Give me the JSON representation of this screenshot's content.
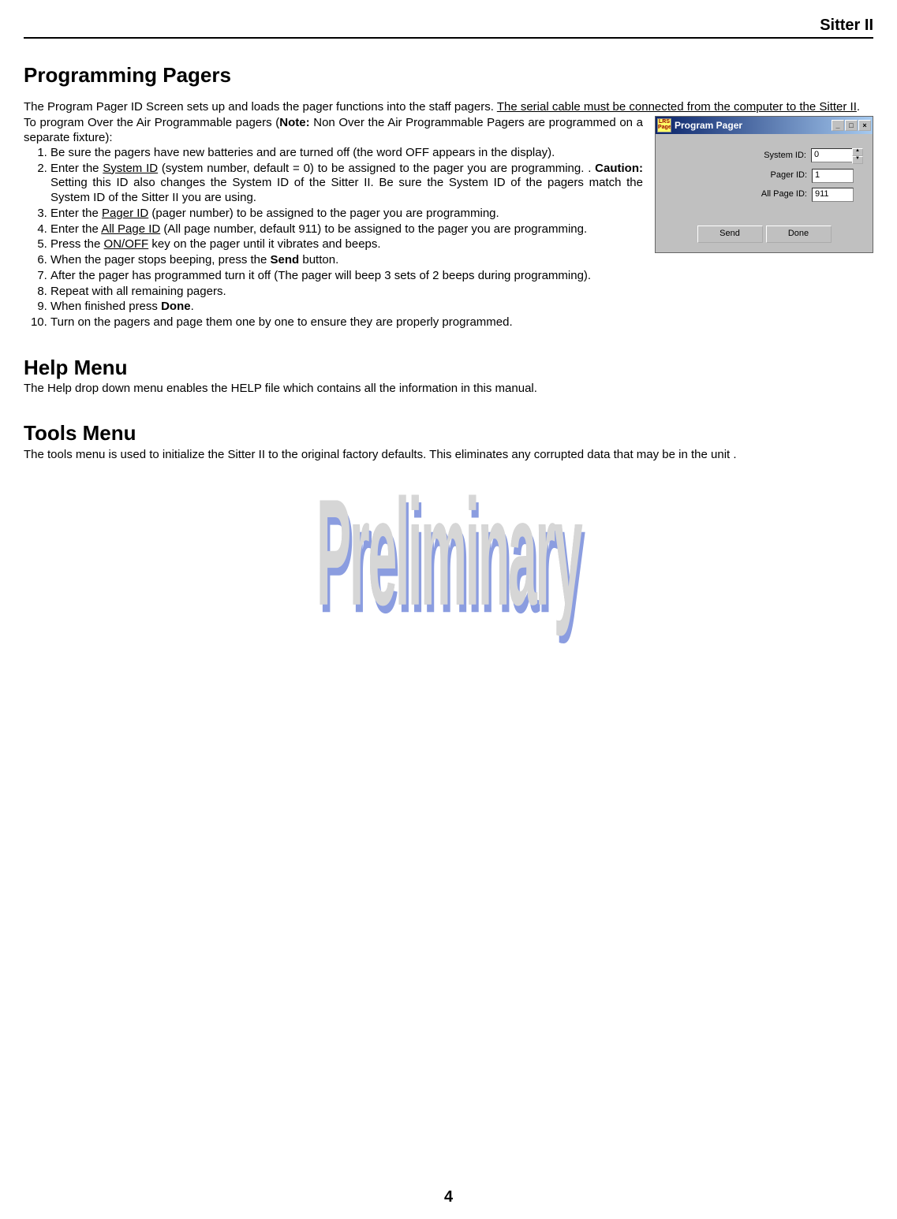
{
  "header": {
    "product": "Sitter II"
  },
  "page_number": "4",
  "section1": {
    "title": "Programming Pagers",
    "intro_a": "The Program Pager ID Screen sets up and loads the pager functions into the staff pagers.   ",
    "intro_b_underline": "The serial cable must be connected from the computer to the Sitter II",
    "intro_b_end": ".",
    "pre_list_a": "To program Over the Air Programmable pagers (",
    "pre_list_note": "Note:",
    "pre_list_b": " Non Over the Air Programmable Pagers are programmed on a separate fixture):",
    "items": [
      {
        "text": "Be sure the pagers have new batteries and are turned off (the word OFF appears in the display)."
      },
      {
        "pref": "Enter the ",
        "u1": "System ID",
        "mid1": " (system number, default = 0) to be assigned to the pager you are programming. .  ",
        "bold1": "Caution:",
        "tail": " Setting this ID also changes the System ID of the Sitter II.  Be sure the System ID of the pagers match the System ID of the Sitter II you are using."
      },
      {
        "pref": "Enter the ",
        "u1": "Pager ID",
        "tail": " (pager number) to be assigned to the pager you are programming."
      },
      {
        "pref": "Enter the ",
        "u1": "All Page ID",
        "tail": " (All page number, default 911) to be assigned to the pager you are programming."
      },
      {
        "pref": "Press the ",
        "u1": "ON/OFF",
        "tail": " key on the pager until it vibrates and beeps."
      },
      {
        "pref": "When the pager stops beeping, press the ",
        "bold1": "Send",
        "tail": " button."
      },
      {
        "text": "After the pager has programmed turn it off (The pager will beep 3 sets of 2 beeps during programming)."
      },
      {
        "text": "Repeat with all remaining pagers."
      },
      {
        "pref": "When finished press ",
        "bold1": "Done",
        "tail": "."
      },
      {
        "text": "Turn on the pagers and page them one by one to ensure they are properly programmed."
      }
    ]
  },
  "section2": {
    "title": "Help Menu",
    "body": "The Help drop down menu enables the HELP file which contains all the information in this manual."
  },
  "section3": {
    "title": "Tools Menu",
    "body": "The tools menu is used to initialize the Sitter II to the original factory defaults.  This eliminates any corrupted data that may be in the unit ."
  },
  "dialog": {
    "icon_text": "LRS Pager",
    "title": "Program Pager",
    "labels": {
      "system_id": "System ID:",
      "pager_id": "Pager ID:",
      "all_page_id": "All Page ID:"
    },
    "fields": {
      "system_id": "0",
      "pager_id": "1",
      "all_page_id": "911"
    },
    "buttons": {
      "send": "Send",
      "done": "Done"
    }
  },
  "watermark": "Preliminary"
}
